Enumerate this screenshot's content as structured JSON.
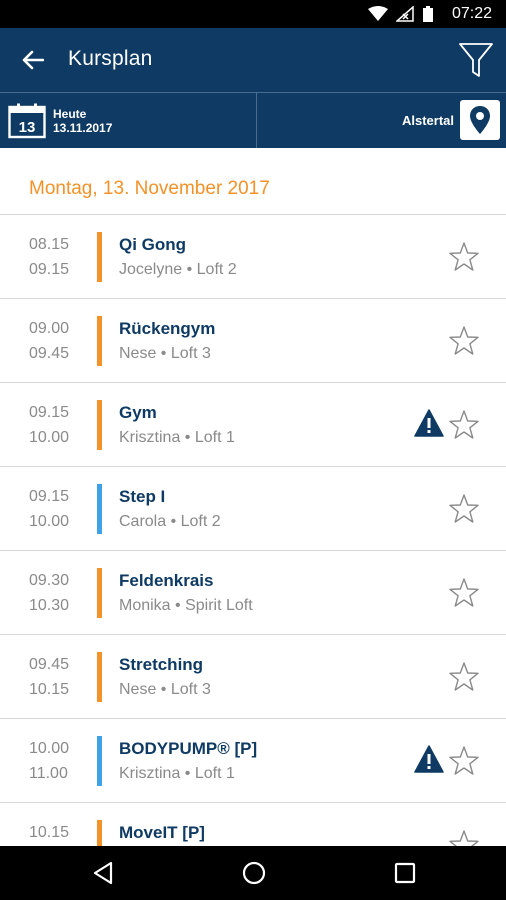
{
  "status": {
    "time": "07:22"
  },
  "header": {
    "title": "Kursplan"
  },
  "date_selector": {
    "day": "13",
    "label": "Heute",
    "date": "13.11.2017"
  },
  "location": {
    "label": "Alstertal"
  },
  "day_heading": "Montag, 13. November 2017",
  "colors": {
    "primary": "#0f3a63",
    "orange": "#f39229",
    "blue": "#3fa2e8"
  },
  "classes": [
    {
      "start": "08.15",
      "end": "09.15",
      "title": "Qi Gong",
      "sub": "Jocelyne • Loft 2",
      "color": "orange",
      "warning": false
    },
    {
      "start": "09.00",
      "end": "09.45",
      "title": "Rückengym",
      "sub": "Nese • Loft 3",
      "color": "orange",
      "warning": false
    },
    {
      "start": "09.15",
      "end": "10.00",
      "title": "Gym",
      "sub": "Krisztina • Loft 1",
      "color": "orange",
      "warning": true
    },
    {
      "start": "09.15",
      "end": "10.00",
      "title": "Step I",
      "sub": "Carola • Loft 2",
      "color": "blue",
      "warning": false
    },
    {
      "start": "09.30",
      "end": "10.30",
      "title": "Feldenkrais",
      "sub": "Monika • Spirit Loft",
      "color": "orange",
      "warning": false
    },
    {
      "start": "09.45",
      "end": "10.15",
      "title": "Stretching",
      "sub": "Nese • Loft 3",
      "color": "orange",
      "warning": false
    },
    {
      "start": "10.00",
      "end": "11.00",
      "title": "BODYPUMP® [P]",
      "sub": "Krisztina • Loft 1",
      "color": "blue",
      "warning": true
    },
    {
      "start": "10.15",
      "end": "",
      "title": "MoveIT [P]",
      "sub": "",
      "color": "orange",
      "warning": false
    }
  ]
}
